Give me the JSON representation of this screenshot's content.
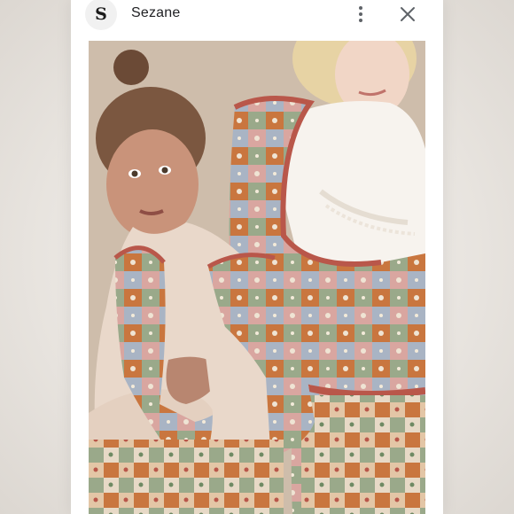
{
  "header": {
    "avatar_letter": "S",
    "title": "Sezane",
    "more_icon": "more-vert-icon",
    "close_icon": "close-icon"
  },
  "photo": {
    "subject": "two-children-patchwork-vests",
    "colors": {
      "background": "#c9b9a6",
      "sweater": "#e9d8ca",
      "blouse": "#f7f3ee",
      "patch_rust": "#c9763f",
      "patch_green": "#9aa98a",
      "patch_blue": "#a9b4c4",
      "patch_pink": "#d9a6a0",
      "trim_red": "#b9574a"
    }
  }
}
